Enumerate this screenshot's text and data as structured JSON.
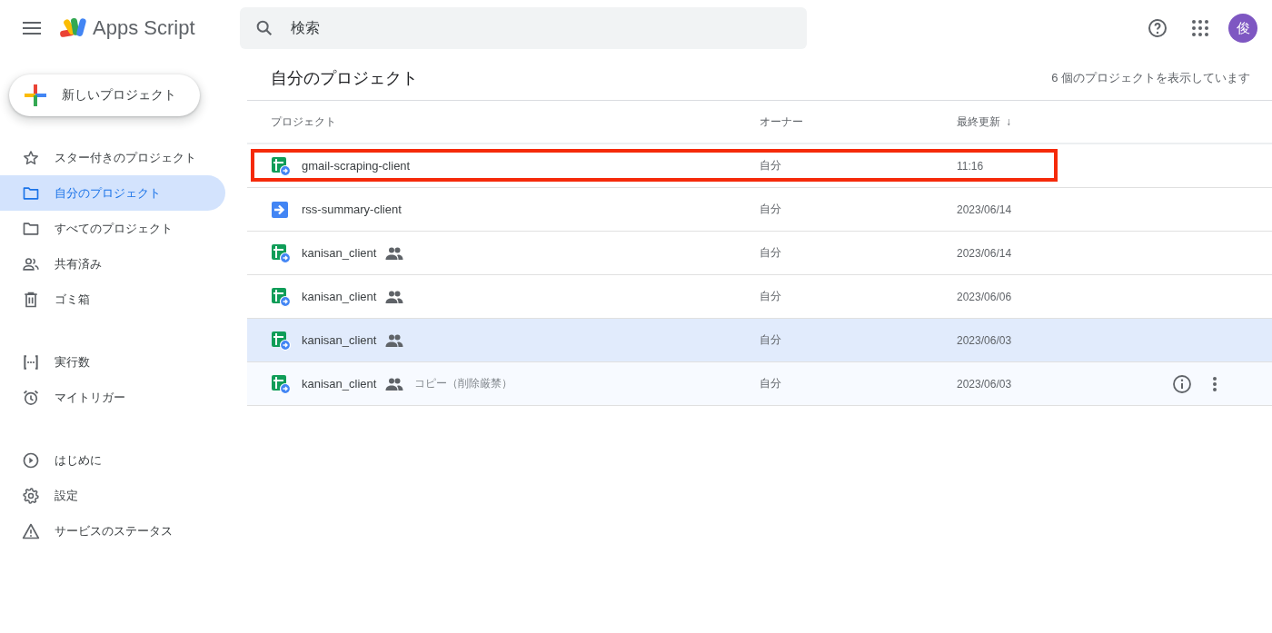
{
  "header": {
    "app_name": "Apps Script",
    "search": {
      "placeholder": "検索"
    },
    "avatar": "俊"
  },
  "sidebar": {
    "new_button": "新しいプロジェクト",
    "groups": [
      [
        {
          "label": "スター付きのプロジェクト",
          "kind": "star",
          "selected": false
        },
        {
          "label": "自分のプロジェクト",
          "kind": "folder",
          "selected": true
        },
        {
          "label": "すべてのプロジェクト",
          "kind": "folder",
          "selected": false
        },
        {
          "label": "共有済み",
          "kind": "people",
          "selected": false
        },
        {
          "label": "ゴミ箱",
          "kind": "trash",
          "selected": false
        }
      ],
      [
        {
          "label": "実行数",
          "kind": "executions",
          "selected": false
        },
        {
          "label": "マイトリガー",
          "kind": "alarm",
          "selected": false
        }
      ],
      [
        {
          "label": "はじめに",
          "kind": "play",
          "selected": false
        },
        {
          "label": "設定",
          "kind": "gear",
          "selected": false
        },
        {
          "label": "サービスのステータス",
          "kind": "warning",
          "selected": false
        }
      ]
    ]
  },
  "main": {
    "title": "自分のプロジェクト",
    "count": "6 個のプロジェクトを表示しています"
  },
  "table": {
    "columns": [
      "プロジェクト",
      "オーナー",
      "最終更新"
    ],
    "sort_arrow": "↓",
    "rows": [
      {
        "kind": "sheet",
        "name": "gmail-scraping-client",
        "shared": false,
        "owner": "自分",
        "updated": "11:16",
        "selected": false,
        "hovered": false,
        "annotated": true
      },
      {
        "kind": "standalone",
        "name": "rss-summary-client",
        "shared": false,
        "owner": "自分",
        "updated": "2023/06/14",
        "selected": false,
        "hovered": false,
        "annotated": false
      },
      {
        "kind": "sheet",
        "name": "kanisan_client",
        "shared": true,
        "owner": "自分",
        "updated": "2023/06/14",
        "selected": false,
        "hovered": false,
        "annotated": false
      },
      {
        "kind": "sheet",
        "name": "kanisan_client",
        "shared": true,
        "owner": "自分",
        "updated": "2023/06/06",
        "selected": false,
        "hovered": false,
        "annotated": false
      },
      {
        "kind": "sheet",
        "name": "kanisan_client",
        "shared": true,
        "owner": "自分",
        "updated": "2023/06/03",
        "selected": true,
        "hovered": false,
        "annotated": false
      },
      {
        "kind": "sheet",
        "name": "kanisan_client",
        "shared": true,
        "note": "コピー（削除厳禁）",
        "owner": "自分",
        "updated": "2023/06/03",
        "selected": false,
        "hovered": true,
        "annotated": false
      }
    ]
  }
}
